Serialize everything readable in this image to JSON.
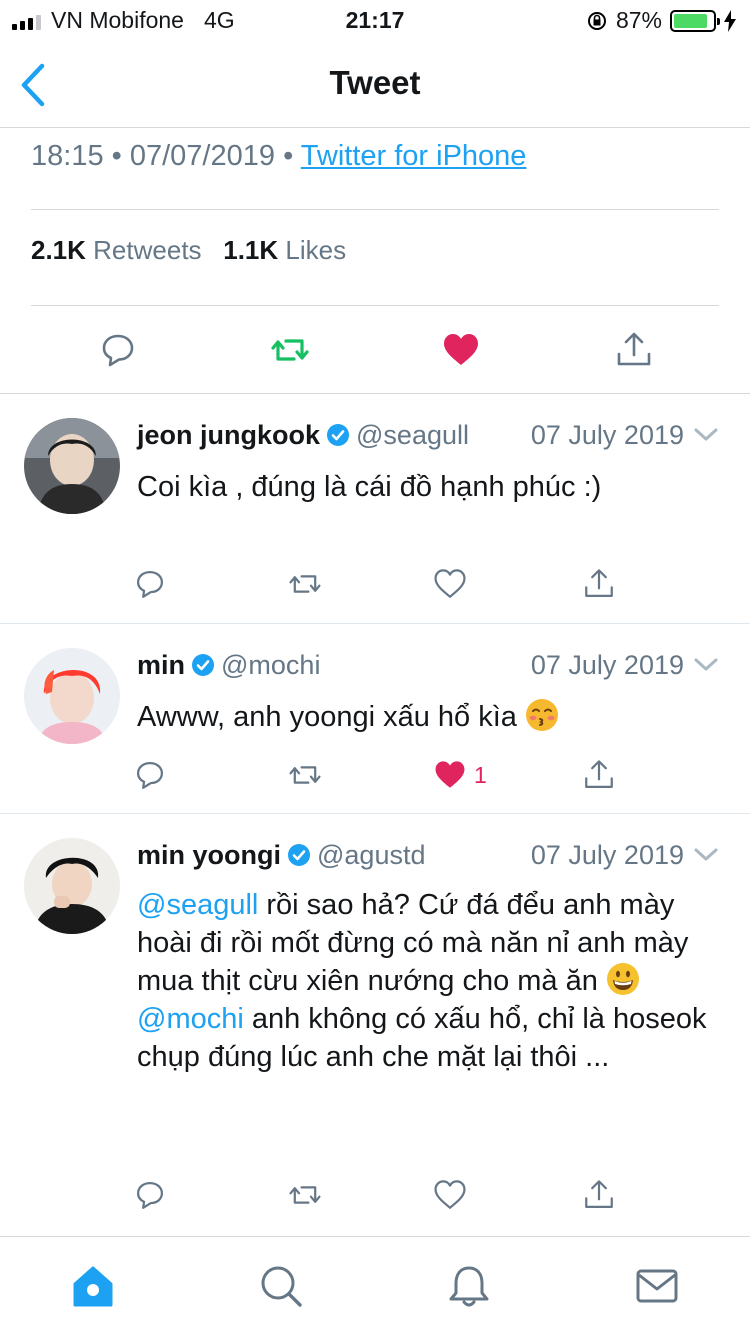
{
  "status_bar": {
    "carrier": "VN Mobifone",
    "network": "4G",
    "time": "21:17",
    "battery": "87%",
    "battery_level": 0.87
  },
  "nav": {
    "title": "Tweet",
    "back_icon": "chevron-left-icon"
  },
  "tweet": {
    "time": "18:15",
    "separator": "•",
    "date": "07/07/2019",
    "source": "Twitter for iPhone",
    "retweets_count": "2.1K",
    "retweets_label": "Retweets",
    "likes_count": "1.1K",
    "likes_label": "Likes",
    "liked": true
  },
  "replies": [
    {
      "name": "jeon jungkook",
      "handle": "@seagull",
      "date": "07 July 2019",
      "verified": true,
      "text": "Coi kìa , đúng là cái đồ hạnh phúc :)",
      "liked": false,
      "like_count": ""
    },
    {
      "name": "min",
      "handle": "@mochi",
      "date": "07 July 2019",
      "verified": true,
      "text": "Awww, anh yoongi xấu hổ kìa",
      "emoji": "kissing-face-emoji",
      "liked": true,
      "like_count": "1"
    },
    {
      "name": "min yoongi",
      "handle": "@agustd",
      "date": "07 July 2019",
      "verified": true,
      "mention1": "@seagull",
      "text1": " rồi sao hả? Cứ đá đểu anh mày hoài đi rồi mốt đừng có mà năn nỉ anh mày mua thịt cừu xiên nướng cho mà ăn ",
      "emoji": "grinning-face-emoji",
      "mention2": "@mochi",
      "text2": " anh không có xấu hổ, chỉ là hoseok chụp đúng lúc anh che mặt lại thôi ...",
      "liked": false,
      "like_count": ""
    }
  ],
  "tabbar": {
    "items": [
      "home-icon",
      "search-icon",
      "notifications-icon",
      "messages-icon"
    ],
    "active": "home-icon"
  },
  "colors": {
    "accent": "#1da1f2",
    "like": "#e0245e",
    "retweet": "#17bf63",
    "secondary_text": "#657786"
  }
}
